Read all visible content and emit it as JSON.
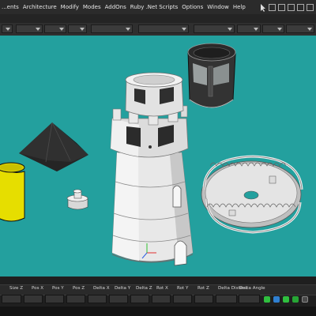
{
  "menu": {
    "items": [
      "...ents",
      "Architecture",
      "Modify",
      "Modes",
      "AddOns",
      "Ruby .Net Scripts",
      "Options",
      "Window",
      "Help"
    ]
  },
  "status": {
    "labels": [
      "Size Z",
      "Pos X",
      "Pos Y",
      "Pos Z",
      "Delta X",
      "Delta Y",
      "Delta Z",
      "Rot X",
      "Rot Y",
      "Rot Z",
      "Delta Distanc",
      "Delta Angle"
    ]
  },
  "colors": {
    "viewport_bg": "#23a09e",
    "model": "#eeeeee",
    "cylinder": "#e8e000",
    "cone": "#2e2e2e",
    "status_green": "#2fbf3f",
    "status_blue": "#2f7fd0"
  }
}
